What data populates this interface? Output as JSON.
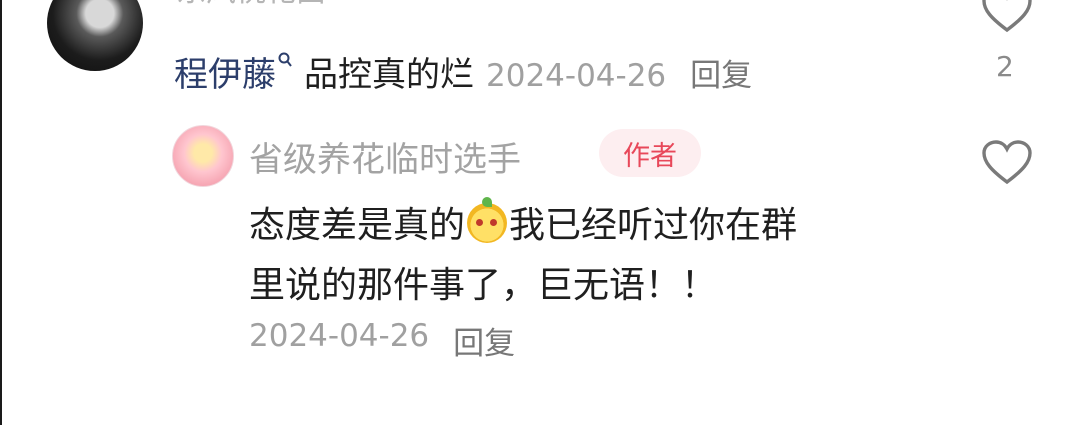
{
  "top_comment": {
    "username_cut": "东风桃花面"
  },
  "reply": {
    "username": "程伊藤",
    "text": "品控真的烂",
    "date": "2024-04-26",
    "reply_label": "回复",
    "like_count": "2"
  },
  "author_reply": {
    "username": "省级养花临时选手",
    "badge": "作者",
    "text_part1": "态度差是真的",
    "text_part2": "我已经听过你在群",
    "text_line2": "里说的那件事了，巨无语！！",
    "date": "2024-04-26",
    "reply_label": "回复"
  },
  "icons": {
    "user_search": "search-icon",
    "like": "heart-outline-icon",
    "emoji": "pear-emoji-icon"
  },
  "colors": {
    "username_link": "#2c3e6b",
    "badge_text": "#e8485a",
    "badge_bg": "#fdeef0",
    "meta_text": "#a0a0a0"
  }
}
